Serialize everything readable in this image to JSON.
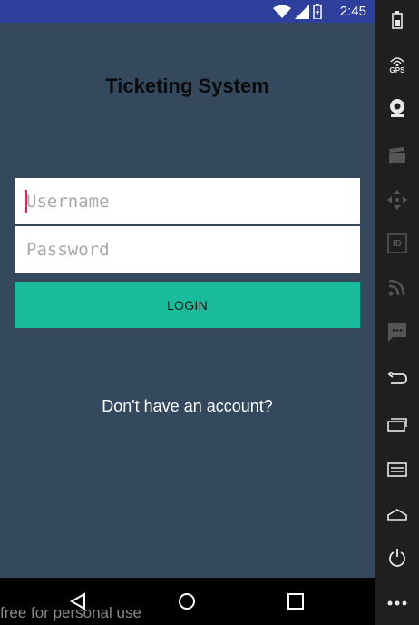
{
  "status": {
    "time": "2:45"
  },
  "app": {
    "title": "Ticketing System",
    "username_placeholder": "Username",
    "password_placeholder": "Password",
    "login_label": "LOGIN",
    "signup_link": "Don't have an account?"
  },
  "watermark": "free for personal use",
  "emulator_sidebar": {
    "gps_label": "GPS",
    "id_label": "ID",
    "items": [
      "battery-icon",
      "gps-icon",
      "camera-icon",
      "video-icon",
      "dpad-icon",
      "id-icon",
      "rss-icon",
      "sms-icon",
      "back-icon",
      "recents-icon",
      "menu-icon",
      "home-icon",
      "power-icon",
      "more-icon"
    ]
  },
  "colors": {
    "background": "#34495e",
    "statusbar": "#2e3f9e",
    "login_button": "#1abc9c",
    "caret": "#e91e63"
  }
}
